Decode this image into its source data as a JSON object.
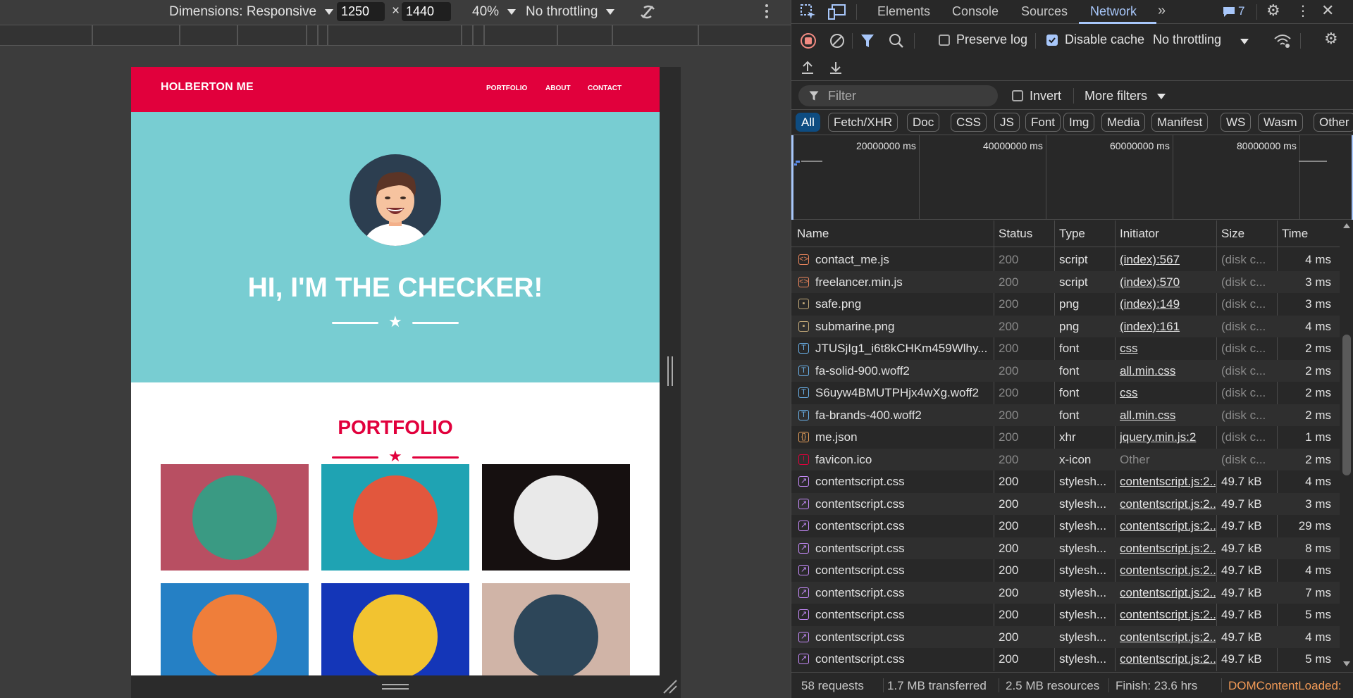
{
  "emulation": {
    "dimensions_label": "Dimensions: Responsive",
    "width": "1250",
    "height": "1440",
    "times": "×",
    "zoom": "40%",
    "throttling": "No throttling"
  },
  "site": {
    "brand": "HOLBERTON ME",
    "nav": [
      "PORTFOLIO",
      "ABOUT",
      "CONTACT"
    ],
    "hero_title": "HI, I'M THE CHECKER!",
    "section_title": "PORTFOLIO",
    "colors": {
      "nav": "#e1003c",
      "hero": "#78cdd2",
      "accent": "#e1003c"
    },
    "tiles": [
      {
        "icon": "cabin-icon",
        "bg": "#b84f62",
        "circle": "#3a9a83"
      },
      {
        "icon": "cake-icon",
        "bg": "#1fa3b3",
        "circle": "#e2573d"
      },
      {
        "icon": "circus-tent-icon",
        "bg": "#161010",
        "circle": "#e9e9e9"
      },
      {
        "icon": "game-controller-icon",
        "bg": "#2580c5",
        "circle": "#ef7e3a"
      },
      {
        "icon": "safe-icon",
        "bg": "#1436b8",
        "circle": "#f2c330"
      },
      {
        "icon": "submarine-icon",
        "bg": "#d0b4a7",
        "circle": "#2d4659"
      }
    ]
  },
  "devtools": {
    "tabs": [
      "Elements",
      "Console",
      "Sources",
      "Network"
    ],
    "active_tab": "Network",
    "issues_count": "7",
    "preserve_log": "Preserve log",
    "disable_cache": "Disable cache",
    "throttling": "No throttling",
    "filter_placeholder": "Filter",
    "invert": "Invert",
    "more_filters": "More filters",
    "type_filters": [
      "All",
      "Fetch/XHR",
      "Doc",
      "CSS",
      "JS",
      "Font",
      "Img",
      "Media",
      "Manifest",
      "WS",
      "Wasm",
      "Other"
    ],
    "overview_labels": [
      "20000000 ms",
      "40000000 ms",
      "60000000 ms",
      "80000000 ms"
    ],
    "columns": [
      "Name",
      "Status",
      "Type",
      "Initiator",
      "Size",
      "Time"
    ],
    "rows": [
      {
        "icon": "script-icon",
        "name": "contact_me.js",
        "status": "200",
        "type": "script",
        "initiator": "(index):567",
        "size": "(disk c...",
        "time": "4 ms",
        "dim": true
      },
      {
        "icon": "script-icon",
        "name": "freelancer.min.js",
        "status": "200",
        "type": "script",
        "initiator": "(index):570",
        "size": "(disk c...",
        "time": "3 ms",
        "dim": true
      },
      {
        "icon": "image-icon",
        "name": "safe.png",
        "status": "200",
        "type": "png",
        "initiator": "(index):149",
        "size": "(disk c...",
        "time": "3 ms",
        "dim": true
      },
      {
        "icon": "image-icon",
        "name": "submarine.png",
        "status": "200",
        "type": "png",
        "initiator": "(index):161",
        "size": "(disk c...",
        "time": "4 ms",
        "dim": true
      },
      {
        "icon": "font-icon",
        "name": "JTUSjIg1_i6t8kCHKm459Wlhy...",
        "status": "200",
        "type": "font",
        "initiator": "css",
        "size": "(disk c...",
        "time": "2 ms",
        "dim": true
      },
      {
        "icon": "font-icon",
        "name": "fa-solid-900.woff2",
        "status": "200",
        "type": "font",
        "initiator": "all.min.css",
        "size": "(disk c...",
        "time": "2 ms",
        "dim": true
      },
      {
        "icon": "font-icon",
        "name": "S6uyw4BMUTPHjx4wXg.woff2",
        "status": "200",
        "type": "font",
        "initiator": "css",
        "size": "(disk c...",
        "time": "2 ms",
        "dim": true
      },
      {
        "icon": "font-icon",
        "name": "fa-brands-400.woff2",
        "status": "200",
        "type": "font",
        "initiator": "all.min.css",
        "size": "(disk c...",
        "time": "2 ms",
        "dim": true
      },
      {
        "icon": "json-icon",
        "name": "me.json",
        "status": "200",
        "type": "xhr",
        "initiator": "jquery.min.js:2",
        "size": "(disk c...",
        "time": "1 ms",
        "dim": true
      },
      {
        "icon": "favicon-icon",
        "name": "favicon.ico",
        "status": "200",
        "type": "x-icon",
        "initiator": "Other",
        "size": "(disk c...",
        "time": "2 ms",
        "dim": true
      },
      {
        "icon": "stylesheet-icon",
        "name": "contentscript.css",
        "status": "200",
        "type": "stylesh...",
        "initiator": "contentscript.js:2...",
        "size": "49.7 kB",
        "time": "4 ms",
        "dim": false
      },
      {
        "icon": "stylesheet-icon",
        "name": "contentscript.css",
        "status": "200",
        "type": "stylesh...",
        "initiator": "contentscript.js:2...",
        "size": "49.7 kB",
        "time": "3 ms",
        "dim": false
      },
      {
        "icon": "stylesheet-icon",
        "name": "contentscript.css",
        "status": "200",
        "type": "stylesh...",
        "initiator": "contentscript.js:2...",
        "size": "49.7 kB",
        "time": "29 ms",
        "dim": false
      },
      {
        "icon": "stylesheet-icon",
        "name": "contentscript.css",
        "status": "200",
        "type": "stylesh...",
        "initiator": "contentscript.js:2...",
        "size": "49.7 kB",
        "time": "8 ms",
        "dim": false
      },
      {
        "icon": "stylesheet-icon",
        "name": "contentscript.css",
        "status": "200",
        "type": "stylesh...",
        "initiator": "contentscript.js:2...",
        "size": "49.7 kB",
        "time": "4 ms",
        "dim": false
      },
      {
        "icon": "stylesheet-icon",
        "name": "contentscript.css",
        "status": "200",
        "type": "stylesh...",
        "initiator": "contentscript.js:2...",
        "size": "49.7 kB",
        "time": "7 ms",
        "dim": false
      },
      {
        "icon": "stylesheet-icon",
        "name": "contentscript.css",
        "status": "200",
        "type": "stylesh...",
        "initiator": "contentscript.js:2...",
        "size": "49.7 kB",
        "time": "5 ms",
        "dim": false
      },
      {
        "icon": "stylesheet-icon",
        "name": "contentscript.css",
        "status": "200",
        "type": "stylesh...",
        "initiator": "contentscript.js:2...",
        "size": "49.7 kB",
        "time": "4 ms",
        "dim": false
      },
      {
        "icon": "stylesheet-icon",
        "name": "contentscript.css",
        "status": "200",
        "type": "stylesh...",
        "initiator": "contentscript.js:2...",
        "size": "49.7 kB",
        "time": "5 ms",
        "dim": false
      }
    ],
    "status_bar": {
      "requests": "58 requests",
      "transferred": "1.7 MB transferred",
      "resources": "2.5 MB resources",
      "finish": "Finish: 23.6 hrs",
      "dom_content_loaded": "DOMContentLoaded:"
    }
  }
}
